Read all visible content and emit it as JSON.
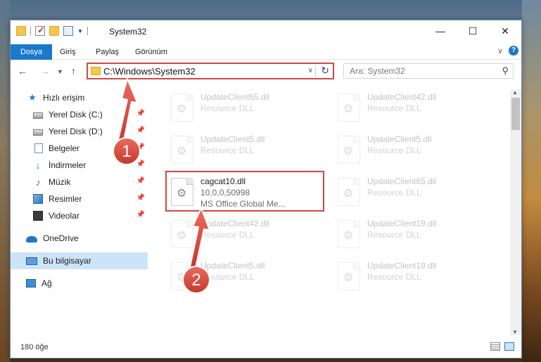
{
  "window": {
    "title": "System32",
    "controls": {
      "minimize": "—",
      "maximize": "☐",
      "close": "✕"
    }
  },
  "ribbon": {
    "tabs": [
      "Dosya",
      "Giriş",
      "Paylaş",
      "Görünüm"
    ],
    "help": "?"
  },
  "nav": {
    "address": "C:\\Windows\\System32",
    "search_placeholder": "Ara: System32"
  },
  "sidebar": {
    "items": [
      {
        "label": "Hızlı erişim",
        "icon": "star-icon"
      },
      {
        "label": "Yerel Disk (C:)",
        "icon": "drive-icon",
        "pinned": true
      },
      {
        "label": "Yerel Disk (D:)",
        "icon": "drive-icon",
        "pinned": true
      },
      {
        "label": "Belgeler",
        "icon": "documents-icon",
        "pinned": true
      },
      {
        "label": "İndirmeler",
        "icon": "downloads-icon",
        "pinned": true
      },
      {
        "label": "Müzik",
        "icon": "music-icon",
        "pinned": true
      },
      {
        "label": "Resimler",
        "icon": "pictures-icon",
        "pinned": true
      },
      {
        "label": "Videolar",
        "icon": "videos-icon",
        "pinned": true
      },
      {
        "label": "OneDrive",
        "icon": "onedrive-icon"
      },
      {
        "label": "Bu bilgisayar",
        "icon": "computer-icon",
        "selected": true
      },
      {
        "label": "Ağ",
        "icon": "network-icon"
      }
    ]
  },
  "files": [
    {
      "name": "UpdateClient65.dll",
      "type": "Resource DLL"
    },
    {
      "name": "UpdateClient42.dll",
      "type": "Resource DLL"
    },
    {
      "name": "UpdateClient5.dll",
      "type": "Resource DLL"
    },
    {
      "name": "UpdateClient5.dll",
      "type": "Resource DLL"
    },
    {
      "name": "cagcat10.dll",
      "version": "10,0,0,50998",
      "type": "MS Office Global Me..."
    },
    {
      "name": "UpdateClient65.dll",
      "type": "Resource DLL"
    },
    {
      "name": "UpdateClient42.dll",
      "type": "Resource DLL"
    },
    {
      "name": "UpdateClient19.dll",
      "type": "Resource DLL"
    },
    {
      "name": "UpdateClient5.dll",
      "type": "Resource DLL"
    },
    {
      "name": "UpdateClient19.dll",
      "type": "Resource DLL"
    }
  ],
  "status": {
    "item_count": "180 öğe"
  },
  "annotations": [
    {
      "number": "1"
    },
    {
      "number": "2"
    }
  ],
  "colors": {
    "accent": "#1979ca",
    "highlight_box": "#d64545",
    "selected_bg": "#cce4f7"
  }
}
